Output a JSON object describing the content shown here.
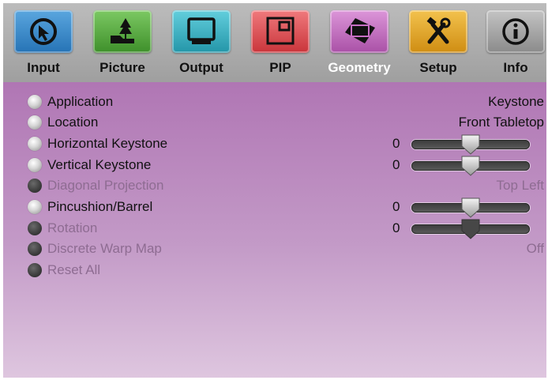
{
  "tabs": [
    {
      "id": "input",
      "label": "Input",
      "icon": "input-arrow-icon",
      "color": "#2f86c8",
      "active": false
    },
    {
      "id": "picture",
      "label": "Picture",
      "icon": "landscape-tree-icon",
      "color": "#4ea534",
      "active": false
    },
    {
      "id": "output",
      "label": "Output",
      "icon": "monitor-icon",
      "color": "#2fb3c8",
      "active": false
    },
    {
      "id": "pip",
      "label": "PIP",
      "icon": "pip-window-icon",
      "color": "#e5484d",
      "active": false
    },
    {
      "id": "geometry",
      "label": "Geometry",
      "icon": "rotated-rect-icon",
      "color": "#c86fc4",
      "active": true
    },
    {
      "id": "setup",
      "label": "Setup",
      "icon": "tools-icon",
      "color": "#e6a820",
      "active": false
    },
    {
      "id": "info",
      "label": "Info",
      "icon": "info-icon",
      "color": "#9a9a9a",
      "active": false
    }
  ],
  "menu": [
    {
      "id": "application",
      "label": "Application",
      "enabled": true,
      "value": "Keystone"
    },
    {
      "id": "location",
      "label": "Location",
      "enabled": true,
      "value": "Front Tabletop"
    },
    {
      "id": "horizontal-keystone",
      "label": "Horizontal Keystone",
      "enabled": true,
      "slider": {
        "value": "0",
        "position": 0.5
      }
    },
    {
      "id": "vertical-keystone",
      "label": "Vertical Keystone",
      "enabled": true,
      "slider": {
        "value": "0",
        "position": 0.5
      }
    },
    {
      "id": "diagonal-projection",
      "label": "Diagonal Projection",
      "enabled": false,
      "value": "Top Left"
    },
    {
      "id": "pincushion-barrel",
      "label": "Pincushion/Barrel",
      "enabled": true,
      "slider": {
        "value": "0",
        "position": 0.5
      }
    },
    {
      "id": "rotation",
      "label": "Rotation",
      "enabled": false,
      "slider": {
        "value": "0",
        "position": 0.5
      }
    },
    {
      "id": "discrete-warp-map",
      "label": "Discrete Warp Map",
      "enabled": false,
      "value": "Off"
    },
    {
      "id": "reset-all",
      "label": "Reset All",
      "enabled": false
    }
  ]
}
